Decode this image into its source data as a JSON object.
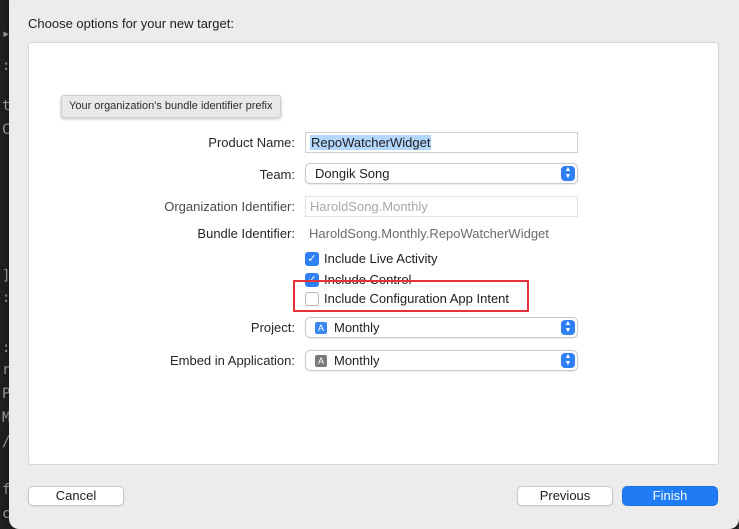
{
  "dialog": {
    "title": "Choose options for your new target:"
  },
  "tooltip": {
    "text": "Your organization's bundle identifier prefix"
  },
  "form": {
    "product_name": {
      "label": "Product Name:",
      "value": "RepoWatcherWidget"
    },
    "team": {
      "label": "Team:",
      "value": "Dongik Song"
    },
    "organization_identifier": {
      "label": "Organization Identifier:",
      "value": "HaroldSong.Monthly"
    },
    "bundle_identifier": {
      "label": "Bundle Identifier:",
      "value": "HaroldSong.Monthly.RepoWatcherWidget"
    },
    "checkboxes": [
      {
        "label": "Include Live Activity",
        "checked": true
      },
      {
        "label": "Include Control",
        "checked": true
      },
      {
        "label": "Include Configuration App Intent",
        "checked": false
      }
    ],
    "project": {
      "label": "Project:",
      "value": "Monthly"
    },
    "embed_in_application": {
      "label": "Embed in Application:",
      "value": "Monthly"
    }
  },
  "buttons": {
    "cancel": "Cancel",
    "previous": "Previous",
    "finish": "Finish"
  },
  "icons": {
    "checkmark": "✓",
    "stepper_up": "▲",
    "stepper_down": "▼"
  },
  "colors": {
    "accent": "#1f7cf4",
    "highlight": "#e8303d",
    "selection": "#b3d6fd"
  }
}
